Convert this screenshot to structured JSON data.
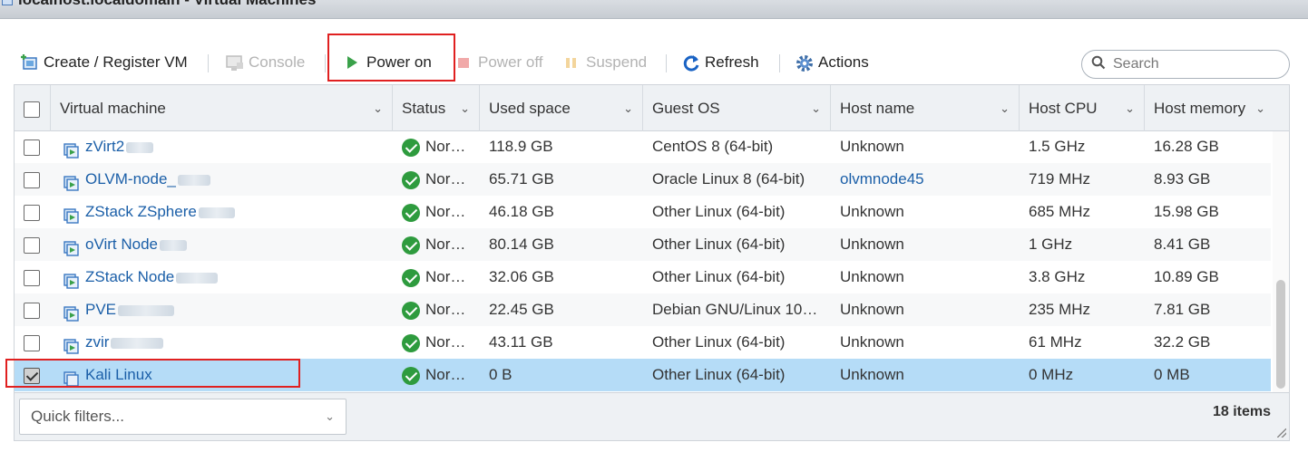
{
  "window": {
    "title": "localhost.localdomain - Virtual Machines"
  },
  "toolbar": {
    "create_label": "Create / Register VM",
    "console_label": "Console",
    "power_on_label": "Power on",
    "power_off_label": "Power off",
    "suspend_label": "Suspend",
    "refresh_label": "Refresh",
    "actions_label": "Actions"
  },
  "search": {
    "placeholder": "Search"
  },
  "columns": {
    "vm": "Virtual machine",
    "status": "Status",
    "used": "Used space",
    "os": "Guest OS",
    "host": "Host name",
    "cpu": "Host CPU",
    "mem": "Host memory"
  },
  "rows": [
    {
      "name": "zVirt2",
      "status": "Nor…",
      "used": "118.9 GB",
      "os": "CentOS 8 (64-bit)",
      "host": "Unknown",
      "cpu": "1.5 GHz",
      "mem": "16.28 GB",
      "checked": false,
      "selected": false
    },
    {
      "name": "OLVM-node_",
      "status": "Nor…",
      "used": "65.71 GB",
      "os": "Oracle Linux 8 (64-bit)",
      "host": "olvmnode45",
      "cpu": "719 MHz",
      "mem": "8.93 GB",
      "checked": false,
      "selected": false
    },
    {
      "name": "ZStack ZSphere",
      "status": "Nor…",
      "used": "46.18 GB",
      "os": "Other Linux (64-bit)",
      "host": "Unknown",
      "cpu": "685 MHz",
      "mem": "15.98 GB",
      "checked": false,
      "selected": false
    },
    {
      "name": "oVirt Node",
      "status": "Nor…",
      "used": "80.14 GB",
      "os": "Other Linux (64-bit)",
      "host": "Unknown",
      "cpu": "1 GHz",
      "mem": "8.41 GB",
      "checked": false,
      "selected": false
    },
    {
      "name": "ZStack Node",
      "status": "Nor…",
      "used": "32.06 GB",
      "os": "Other Linux (64-bit)",
      "host": "Unknown",
      "cpu": "3.8 GHz",
      "mem": "10.89 GB",
      "checked": false,
      "selected": false
    },
    {
      "name": "PVE",
      "status": "Nor…",
      "used": "22.45 GB",
      "os": "Debian GNU/Linux 10…",
      "host": "Unknown",
      "cpu": "235 MHz",
      "mem": "7.81 GB",
      "checked": false,
      "selected": false
    },
    {
      "name": "zvir",
      "status": "Nor…",
      "used": "43.11 GB",
      "os": "Other Linux (64-bit)",
      "host": "Unknown",
      "cpu": "61 MHz",
      "mem": "32.2 GB",
      "checked": false,
      "selected": false
    },
    {
      "name": "Kali Linux",
      "status": "Nor…",
      "used": "0 B",
      "os": "Other Linux (64-bit)",
      "host": "Unknown",
      "cpu": "0 MHz",
      "mem": "0 MB",
      "checked": true,
      "selected": true
    }
  ],
  "footer": {
    "quick_filter": "Quick filters...",
    "item_count": "18 items"
  },
  "colors": {
    "link": "#1b5fa8",
    "selected_row": "#b5dcf7",
    "status_ok": "#2e9b3e",
    "highlight": "#e02020"
  }
}
